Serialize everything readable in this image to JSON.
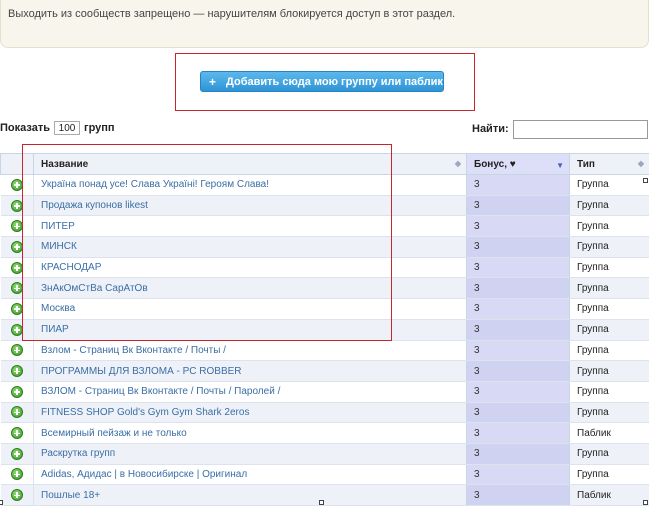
{
  "notice": {
    "text": "Выходить из сообществ запрещено — нарушителям блокируется доступ в этот раздел."
  },
  "add_button": {
    "icon": "plus-icon",
    "label": "Добавить сюда мою группу или паблик"
  },
  "controls": {
    "show_prefix": "Показать",
    "show_value": "100",
    "show_suffix": "групп",
    "find_label": "Найти:",
    "find_value": ""
  },
  "table": {
    "columns": {
      "name": "Название",
      "bonus": "Бонус, ♥",
      "type": "Тип"
    },
    "rows": [
      {
        "name": "Україна понад усе! Слава Україні! Героям Слава!",
        "bonus": "3",
        "type": "Группа"
      },
      {
        "name": "Продажа купонов likest",
        "bonus": "3",
        "type": "Группа"
      },
      {
        "name": "ПИТЕР",
        "bonus": "3",
        "type": "Группа"
      },
      {
        "name": "МИНСК",
        "bonus": "3",
        "type": "Группа"
      },
      {
        "name": "КРАСНОДАР",
        "bonus": "3",
        "type": "Группа"
      },
      {
        "name": "ЗнАкОмСтВа СарАтОв",
        "bonus": "3",
        "type": "Группа"
      },
      {
        "name": "Москва",
        "bonus": "3",
        "type": "Группа"
      },
      {
        "name": "ПИАР",
        "bonus": "3",
        "type": "Группа"
      },
      {
        "name": "Взлом - Страниц Вк Вконтакте / Почты /",
        "bonus": "3",
        "type": "Группа"
      },
      {
        "name": "ПРОГРАММЫ ДЛЯ ВЗЛОМА - PC ROBBER",
        "bonus": "3",
        "type": "Группа"
      },
      {
        "name": "ВЗЛОМ - Страниц Вк Вконтакте / Почты / Паролей /",
        "bonus": "3",
        "type": "Группа"
      },
      {
        "name": "FITNESS SHOP Gold's Gym Gym Shark 2eros",
        "bonus": "3",
        "type": "Группа"
      },
      {
        "name": "Всемирный пейзаж и не только",
        "bonus": "3",
        "type": "Паблик"
      },
      {
        "name": "Раскрутка групп",
        "bonus": "3",
        "type": "Группа"
      },
      {
        "name": "Adidas, Адидас | в Новосибирске | Оригинал",
        "bonus": "3",
        "type": "Группа"
      },
      {
        "name": "Пошлые 18+",
        "bonus": "3",
        "type": "Паблик"
      }
    ]
  },
  "colors": {
    "accent": "#2e94d6",
    "highlight": "#c8262c",
    "link": "#3a6ea5"
  }
}
